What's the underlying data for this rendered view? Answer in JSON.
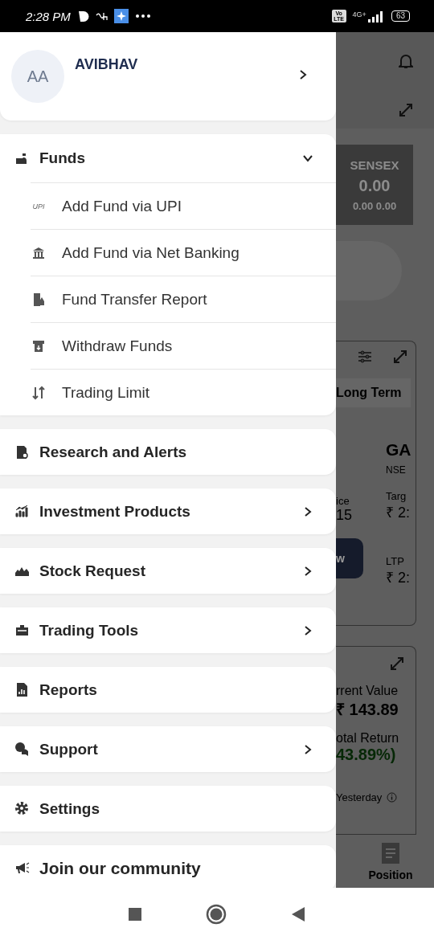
{
  "status_bar": {
    "time": "2:28 PM",
    "volte": "Vo LTE",
    "network": "4G+",
    "battery": "63"
  },
  "profile": {
    "initials": "AA",
    "name": "AVIBHAV"
  },
  "menu": [
    {
      "kind": "group",
      "label": "Funds",
      "expanded": true,
      "children": [
        {
          "label": "Add Fund via UPI",
          "badge": "UPI"
        },
        {
          "label": "Add Fund via Net Banking"
        },
        {
          "label": "Fund Transfer Report"
        },
        {
          "label": "Withdraw Funds"
        },
        {
          "label": "Trading Limit"
        }
      ]
    },
    {
      "kind": "item",
      "label": "Research and Alerts",
      "has_arrow": false
    },
    {
      "kind": "item",
      "label": "Investment Products",
      "has_arrow": true
    },
    {
      "kind": "item",
      "label": "Stock Request",
      "has_arrow": true
    },
    {
      "kind": "item",
      "label": "Trading Tools",
      "has_arrow": true
    },
    {
      "kind": "item",
      "label": "Reports",
      "has_arrow": false
    },
    {
      "kind": "item",
      "label": "Support",
      "has_arrow": true
    },
    {
      "kind": "item",
      "label": "Settings",
      "has_arrow": false
    },
    {
      "kind": "footer",
      "label": "Join our community"
    }
  ],
  "background": {
    "index_name": "SENSEX",
    "index_value": "0.00",
    "index_change": "0.00 0.00",
    "tab": "Long Term",
    "symbol": "GA",
    "exchange": "NSE",
    "price_label": "ice",
    "price_value": "15",
    "target_label": "Targ",
    "target_value": "₹ 2:",
    "button": "w",
    "ltp_label": "LTP",
    "ltp_value": "₹ 2:",
    "current_value_label": "rrent Value",
    "current_value": "₹ 143.89",
    "total_return_label": "otal Return",
    "total_return": "43.89%)",
    "yesterday": "Yesterday",
    "nav_label": "Position"
  }
}
